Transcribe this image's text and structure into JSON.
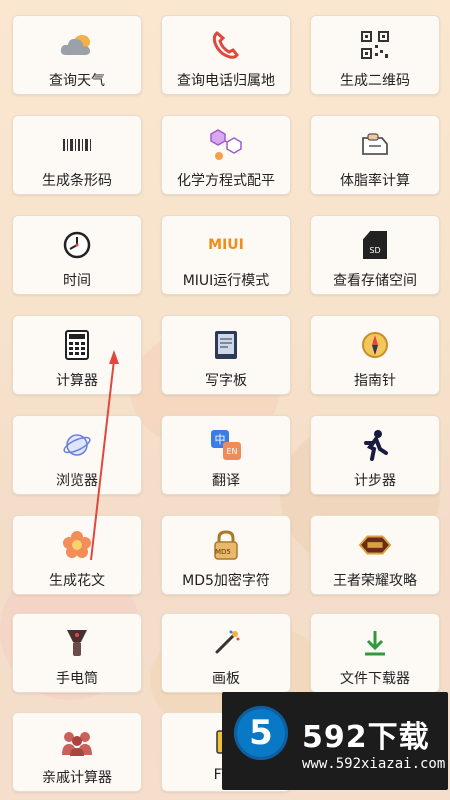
{
  "tiles": [
    {
      "label": "查询天气",
      "icon": "cloud-icon"
    },
    {
      "label": "查询电话归属地",
      "icon": "phone-icon"
    },
    {
      "label": "生成二维码",
      "icon": "qr-code-icon"
    },
    {
      "label": "生成条形码",
      "icon": "barcode-icon"
    },
    {
      "label": "化学方程式配平",
      "icon": "molecule-icon"
    },
    {
      "label": "体脂率计算",
      "icon": "scale-icon"
    },
    {
      "label": "时间",
      "icon": "clock-icon"
    },
    {
      "label": "MIUI运行模式",
      "icon": "miui-icon"
    },
    {
      "label": "查看存储空间",
      "icon": "sd-card-icon"
    },
    {
      "label": "计算器",
      "icon": "calculator-icon"
    },
    {
      "label": "写字板",
      "icon": "notepad-icon"
    },
    {
      "label": "指南针",
      "icon": "compass-icon"
    },
    {
      "label": "浏览器",
      "icon": "globe-icon"
    },
    {
      "label": "翻译",
      "icon": "translate-icon"
    },
    {
      "label": "计步器",
      "icon": "runner-icon"
    },
    {
      "label": "生成花文",
      "icon": "flower-icon"
    },
    {
      "label": "MD5加密字符",
      "icon": "lock-icon"
    },
    {
      "label": "王者荣耀攻略",
      "icon": "game-logo-icon"
    },
    {
      "label": "手电筒",
      "icon": "flashlight-icon"
    },
    {
      "label": "画板",
      "icon": "paint-brush-icon"
    },
    {
      "label": "文件下载器",
      "icon": "download-icon"
    },
    {
      "label": "亲戚计算器",
      "icon": "family-icon"
    },
    {
      "label": "FTP",
      "icon": "ftp-icon"
    }
  ],
  "icon_text": {
    "miui": "MIUI",
    "sd": "SD",
    "md5": "MD5",
    "translate_cn": "中",
    "translate_en": "EN"
  },
  "watermark": {
    "digit": "5",
    "brand": "592下载",
    "url": "www.592xiazai.com"
  },
  "colors": {
    "accent": "#e0483e",
    "tile_bg": "#fdfaf5",
    "watermark_bg": "#1c1c1c",
    "watermark_blue": "#0a79c5"
  }
}
